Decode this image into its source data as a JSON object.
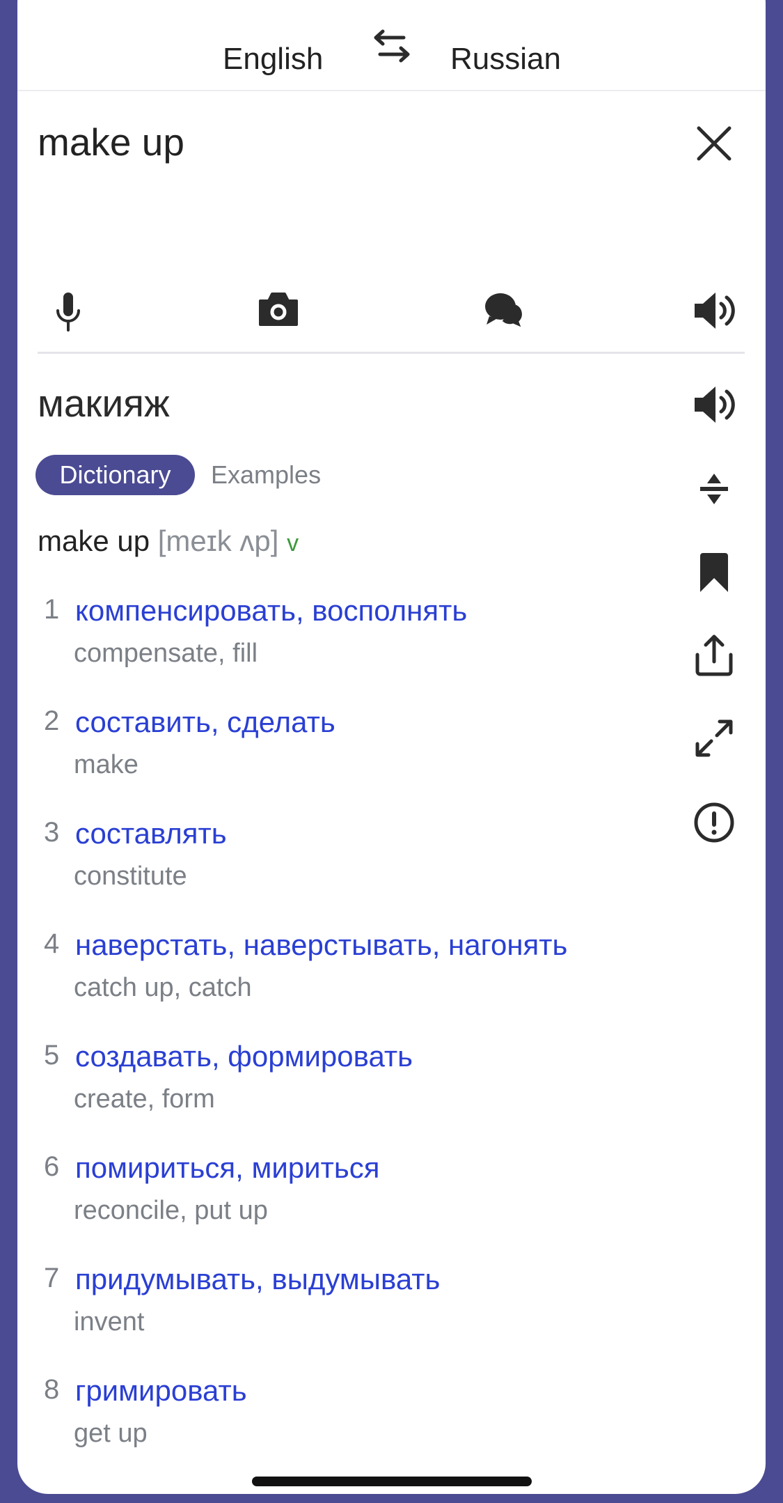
{
  "header": {
    "source_lang": "English",
    "target_lang": "Russian",
    "swap_icon": "swap-arrows-icon"
  },
  "input": {
    "value": "make up",
    "clear_icon": "close-icon"
  },
  "toolbar": {
    "icons": [
      "microphone-icon",
      "camera-icon",
      "dialog-icon",
      "speaker-icon"
    ]
  },
  "result": {
    "translation": "макияж"
  },
  "tabs": [
    {
      "label": "Dictionary",
      "active": true
    },
    {
      "label": "Examples",
      "active": false
    }
  ],
  "dictionary": {
    "headword": "make up",
    "transcription": "[meɪk ʌp]",
    "pos": "v",
    "entries": [
      {
        "num": "1",
        "ru": "компенсировать, восполнять",
        "en": "compensate, fill"
      },
      {
        "num": "2",
        "ru": "составить, сделать",
        "en": "make"
      },
      {
        "num": "3",
        "ru": "составлять",
        "en": "constitute"
      },
      {
        "num": "4",
        "ru": "наверстать, наверстывать, нагонять",
        "en": "catch up, catch"
      },
      {
        "num": "5",
        "ru": "создавать, формировать",
        "en": "create, form"
      },
      {
        "num": "6",
        "ru": "помириться, мириться",
        "en": "reconcile, put up"
      },
      {
        "num": "7",
        "ru": "придумывать, выдумывать",
        "en": "invent"
      },
      {
        "num": "8",
        "ru": "гримировать",
        "en": "get up"
      }
    ]
  },
  "side_actions": [
    "speaker-icon",
    "collapse-icon",
    "bookmark-icon",
    "share-icon",
    "expand-icon",
    "report-icon"
  ],
  "colors": {
    "accent": "#4b4b93",
    "link": "#2a3fd3",
    "pos": "#3c9a3c"
  }
}
